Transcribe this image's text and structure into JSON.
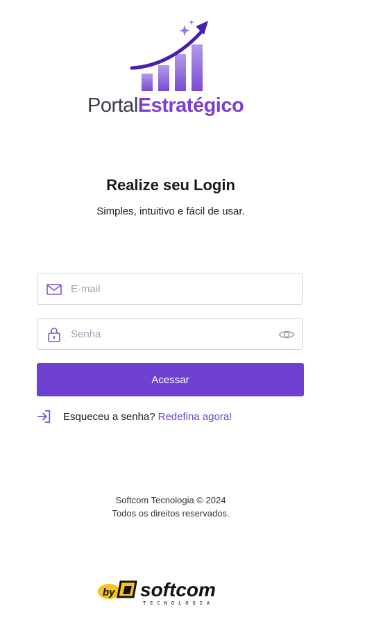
{
  "logo": {
    "text_a": "Portal",
    "text_b": "Estratégico"
  },
  "heading": {
    "title": "Realize seu Login",
    "subtitle": "Simples, intuitivo e fácil de usar."
  },
  "form": {
    "email_placeholder": "E-mail",
    "password_placeholder": "Senha",
    "submit_label": "Acessar",
    "forgot_text": "Esqueceu a senha?",
    "forgot_link": "Redefina agora!"
  },
  "footer": {
    "line1": "Softcom Tecnologia © 2024",
    "line2": "Todos os direitos reservados."
  },
  "brand": {
    "by": "by",
    "name": "softcom",
    "tagline": "TECNOLOGIA"
  },
  "colors": {
    "accent": "#6e41d2",
    "border": "#d1d5db"
  }
}
